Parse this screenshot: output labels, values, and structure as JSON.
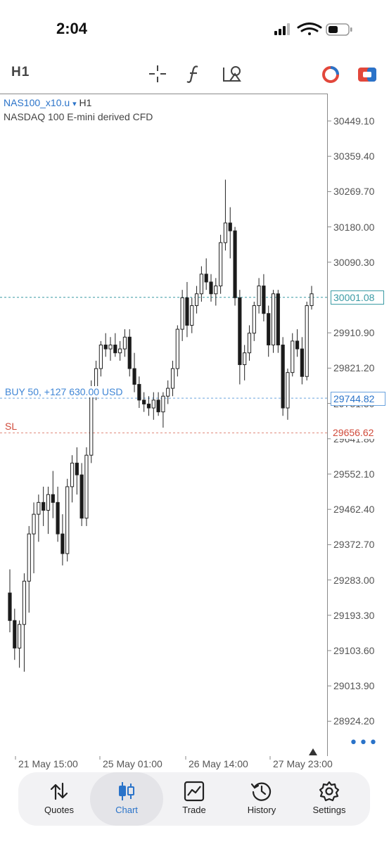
{
  "status_bar": {
    "time": "2:04"
  },
  "toolbar": {
    "timeframe": "H1",
    "icons": [
      "crosshair-icon",
      "function-icon",
      "objects-icon",
      "trade-mode-icon",
      "one-click-trading-icon"
    ]
  },
  "chart": {
    "symbol": "NAS100_x10.u",
    "dropdown_glyph": "▾",
    "timeframe": "H1",
    "description": "NASDAQ 100 E-mini derived CFD",
    "price_ticks": [
      "30449.10",
      "30359.40",
      "30269.70",
      "30180.00",
      "30090.30",
      "29910.90",
      "29821.20",
      "29731.50",
      "29641.80",
      "29552.10",
      "29462.40",
      "29372.70",
      "29283.00",
      "29193.30",
      "29103.60",
      "29013.90",
      "28924.20"
    ],
    "current_price": "30001.08",
    "buy_label": "BUY 50, +127 630.00 USD",
    "buy_price": "29744.82",
    "sl_label": "SL",
    "sl_price": "29656.62",
    "date_ticks": [
      "21 May 15:00",
      "25 May 01:00",
      "26 May 14:00",
      "27 May 23:00"
    ],
    "colors": {
      "bull": "#ffffff",
      "bear": "#1a1a1a",
      "current_line": "#3a9aa4",
      "buy_line": "#6aa3de",
      "sl_line": "#e08a7c"
    }
  },
  "chart_data": {
    "type": "candlestick",
    "title": "NAS100_x10.u H1",
    "ylim": [
      28880,
      30520
    ],
    "candles": [
      {
        "o": 29250,
        "h": 29310,
        "l": 29150,
        "c": 29180
      },
      {
        "o": 29180,
        "h": 29210,
        "l": 29080,
        "c": 29110
      },
      {
        "o": 29110,
        "h": 29180,
        "l": 29060,
        "c": 29170
      },
      {
        "o": 29170,
        "h": 29300,
        "l": 29050,
        "c": 29280
      },
      {
        "o": 29280,
        "h": 29420,
        "l": 29200,
        "c": 29400
      },
      {
        "o": 29400,
        "h": 29480,
        "l": 29300,
        "c": 29450
      },
      {
        "o": 29450,
        "h": 29500,
        "l": 29380,
        "c": 29480
      },
      {
        "o": 29480,
        "h": 29520,
        "l": 29420,
        "c": 29460
      },
      {
        "o": 29460,
        "h": 29520,
        "l": 29400,
        "c": 29500
      },
      {
        "o": 29500,
        "h": 29560,
        "l": 29440,
        "c": 29480
      },
      {
        "o": 29480,
        "h": 29520,
        "l": 29380,
        "c": 29400
      },
      {
        "o": 29400,
        "h": 29450,
        "l": 29320,
        "c": 29350
      },
      {
        "o": 29350,
        "h": 29540,
        "l": 29330,
        "c": 29520
      },
      {
        "o": 29520,
        "h": 29600,
        "l": 29480,
        "c": 29580
      },
      {
        "o": 29580,
        "h": 29620,
        "l": 29500,
        "c": 29550
      },
      {
        "o": 29550,
        "h": 29580,
        "l": 29420,
        "c": 29440
      },
      {
        "o": 29440,
        "h": 29620,
        "l": 29420,
        "c": 29600
      },
      {
        "o": 29600,
        "h": 29790,
        "l": 29580,
        "c": 29770
      },
      {
        "o": 29770,
        "h": 29840,
        "l": 29740,
        "c": 29820
      },
      {
        "o": 29820,
        "h": 29890,
        "l": 29800,
        "c": 29880
      },
      {
        "o": 29880,
        "h": 29910,
        "l": 29850,
        "c": 29870
      },
      {
        "o": 29870,
        "h": 29900,
        "l": 29840,
        "c": 29880
      },
      {
        "o": 29880,
        "h": 29910,
        "l": 29850,
        "c": 29860
      },
      {
        "o": 29860,
        "h": 29890,
        "l": 29840,
        "c": 29870
      },
      {
        "o": 29870,
        "h": 29920,
        "l": 29850,
        "c": 29900
      },
      {
        "o": 29900,
        "h": 29920,
        "l": 29800,
        "c": 29820
      },
      {
        "o": 29820,
        "h": 29860,
        "l": 29760,
        "c": 29780
      },
      {
        "o": 29780,
        "h": 29800,
        "l": 29720,
        "c": 29740
      },
      {
        "o": 29740,
        "h": 29760,
        "l": 29710,
        "c": 29730
      },
      {
        "o": 29730,
        "h": 29750,
        "l": 29700,
        "c": 29720
      },
      {
        "o": 29720,
        "h": 29760,
        "l": 29690,
        "c": 29740
      },
      {
        "o": 29740,
        "h": 29760,
        "l": 29700,
        "c": 29710
      },
      {
        "o": 29710,
        "h": 29760,
        "l": 29670,
        "c": 29750
      },
      {
        "o": 29750,
        "h": 29790,
        "l": 29730,
        "c": 29770
      },
      {
        "o": 29770,
        "h": 29840,
        "l": 29750,
        "c": 29820
      },
      {
        "o": 29820,
        "h": 29930,
        "l": 29800,
        "c": 29920
      },
      {
        "o": 29920,
        "h": 30020,
        "l": 29890,
        "c": 30000
      },
      {
        "o": 30000,
        "h": 30040,
        "l": 29900,
        "c": 29930
      },
      {
        "o": 29930,
        "h": 30000,
        "l": 29910,
        "c": 29980
      },
      {
        "o": 29980,
        "h": 30030,
        "l": 29960,
        "c": 30010
      },
      {
        "o": 30010,
        "h": 30080,
        "l": 29990,
        "c": 30060
      },
      {
        "o": 30060,
        "h": 30100,
        "l": 30020,
        "c": 30040
      },
      {
        "o": 30040,
        "h": 30060,
        "l": 29990,
        "c": 30010
      },
      {
        "o": 30010,
        "h": 30050,
        "l": 29980,
        "c": 30030
      },
      {
        "o": 30030,
        "h": 30160,
        "l": 30010,
        "c": 30140
      },
      {
        "o": 30140,
        "h": 30300,
        "l": 30120,
        "c": 30190
      },
      {
        "o": 30190,
        "h": 30230,
        "l": 30100,
        "c": 30170
      },
      {
        "o": 30170,
        "h": 30180,
        "l": 29980,
        "c": 30000
      },
      {
        "o": 30000,
        "h": 30020,
        "l": 29780,
        "c": 29830
      },
      {
        "o": 29830,
        "h": 29880,
        "l": 29790,
        "c": 29860
      },
      {
        "o": 29860,
        "h": 29930,
        "l": 29840,
        "c": 29910
      },
      {
        "o": 29910,
        "h": 29990,
        "l": 29890,
        "c": 29980
      },
      {
        "o": 29980,
        "h": 30050,
        "l": 29960,
        "c": 30030
      },
      {
        "o": 30030,
        "h": 30060,
        "l": 29940,
        "c": 29960
      },
      {
        "o": 29960,
        "h": 29980,
        "l": 29850,
        "c": 29880
      },
      {
        "o": 29880,
        "h": 30020,
        "l": 29860,
        "c": 30010
      },
      {
        "o": 30010,
        "h": 30020,
        "l": 29860,
        "c": 29880
      },
      {
        "o": 29880,
        "h": 29900,
        "l": 29700,
        "c": 29720
      },
      {
        "o": 29720,
        "h": 29820,
        "l": 29690,
        "c": 29810
      },
      {
        "o": 29810,
        "h": 29910,
        "l": 29800,
        "c": 29890
      },
      {
        "o": 29890,
        "h": 29920,
        "l": 29850,
        "c": 29870
      },
      {
        "o": 29870,
        "h": 29900,
        "l": 29780,
        "c": 29800
      },
      {
        "o": 29800,
        "h": 29990,
        "l": 29790,
        "c": 29980
      },
      {
        "o": 29980,
        "h": 30030,
        "l": 29970,
        "c": 30010
      }
    ]
  },
  "more_glyph": "•••",
  "nav": [
    {
      "label": "Quotes",
      "icon": "quotes-icon"
    },
    {
      "label": "Chart",
      "icon": "chart-candles-icon",
      "active": true
    },
    {
      "label": "Trade",
      "icon": "trade-icon"
    },
    {
      "label": "History",
      "icon": "history-icon"
    },
    {
      "label": "Settings",
      "icon": "settings-icon"
    }
  ]
}
